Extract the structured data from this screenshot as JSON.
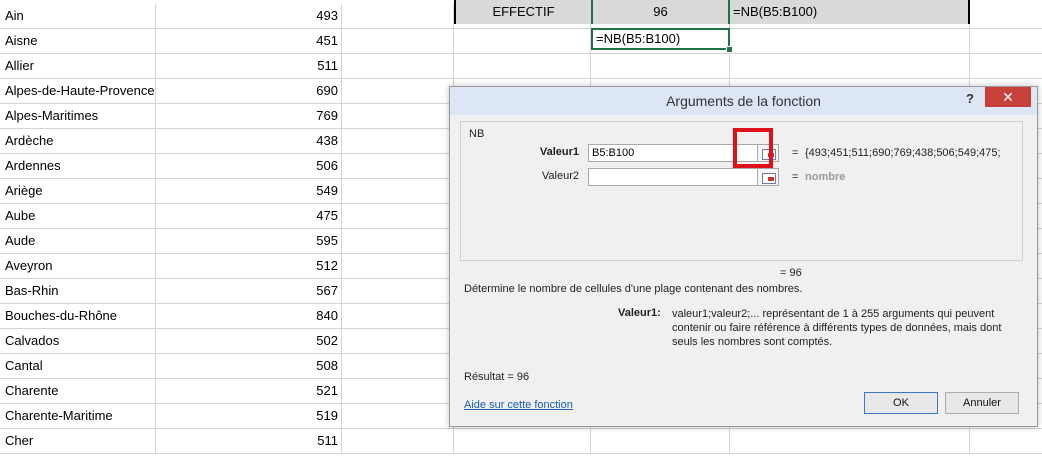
{
  "sheet": {
    "rows": [
      {
        "name": "Ain",
        "value": "493"
      },
      {
        "name": "Aisne",
        "value": "451"
      },
      {
        "name": "Allier",
        "value": "511"
      },
      {
        "name": "Alpes-de-Haute-Provence",
        "value": "690"
      },
      {
        "name": "Alpes-Maritimes",
        "value": "769"
      },
      {
        "name": "Ardèche",
        "value": "438"
      },
      {
        "name": "Ardennes",
        "value": "506"
      },
      {
        "name": "Ariège",
        "value": "549"
      },
      {
        "name": "Aube",
        "value": "475"
      },
      {
        "name": "Aude",
        "value": "595"
      },
      {
        "name": "Aveyron",
        "value": "512"
      },
      {
        "name": "Bas-Rhin",
        "value": "567"
      },
      {
        "name": "Bouches-du-Rhône",
        "value": "840"
      },
      {
        "name": "Calvados",
        "value": "502"
      },
      {
        "name": "Cantal",
        "value": "508"
      },
      {
        "name": "Charente",
        "value": "521"
      },
      {
        "name": "Charente-Maritime",
        "value": "519"
      },
      {
        "name": "Cher",
        "value": "511"
      }
    ],
    "header_label": "EFFECTIF",
    "header_value": "96",
    "header_formula": "=NB(B5:B100)",
    "active_cell_formula": "=NB(B5:B100)"
  },
  "dialog": {
    "title": "Arguments de la fonction",
    "help_symbol": "?",
    "close_symbol": "✕",
    "function_name": "NB",
    "arg1_label": "Valeur1",
    "arg1_value": "B5:B100",
    "arg1_result": "{493;451;511;690;769;438;506;549;475;",
    "arg2_label": "Valeur2",
    "arg2_value": "",
    "arg2_result": "nombre",
    "equals": "=",
    "preview": "=   96",
    "description": "Détermine le nombre de cellules d'une plage contenant des nombres.",
    "arg_help_label": "Valeur1:",
    "arg_help_text": "valeur1;valeur2;... représentant de 1 à 255 arguments qui peuvent contenir ou faire référence à différents types de données, mais dont seuls les nombres sont comptés.",
    "result_text": "Résultat =    96",
    "help_link": "Aide sur cette fonction",
    "ok_label": "OK",
    "cancel_label": "Annuler"
  },
  "colors": {
    "highlight": "#e0101a",
    "selection": "#217346",
    "close_button": "#c7413a"
  }
}
